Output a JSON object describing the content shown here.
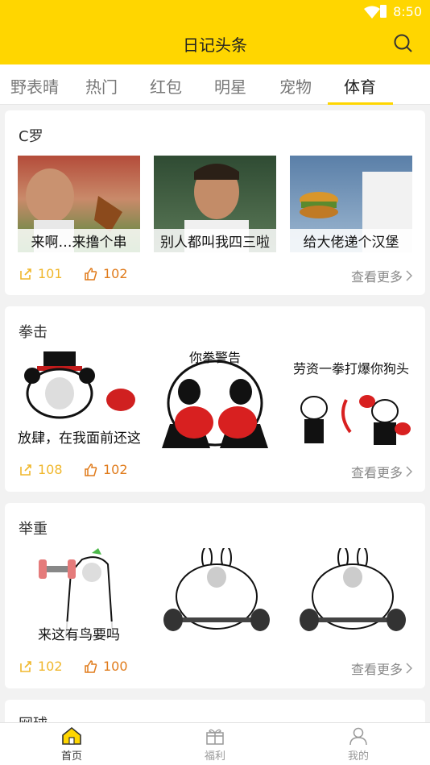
{
  "status": {
    "time": "8:50"
  },
  "appbar": {
    "title": "日记头条",
    "search_icon": "search-icon"
  },
  "tabs": [
    {
      "label": "野表晴"
    },
    {
      "label": "热门"
    },
    {
      "label": "红包"
    },
    {
      "label": "明星"
    },
    {
      "label": "宠物"
    },
    {
      "label": "体育",
      "active": true
    }
  ],
  "cards": [
    {
      "title": "C罗",
      "images": [
        {
          "caption": "来啊…来撸个串"
        },
        {
          "caption": "别人都叫我四三啦"
        },
        {
          "caption": "给大佬递个汉堡"
        }
      ],
      "shares": "101",
      "likes": "102",
      "more": "查看更多"
    },
    {
      "title": "拳击",
      "images": [
        {
          "caption": "放肆，在我面前还这么嚣张！"
        },
        {
          "caption": "你拳警告"
        },
        {
          "caption": "劳资一拳打爆你狗头"
        }
      ],
      "shares": "108",
      "likes": "102",
      "more": "查看更多"
    },
    {
      "title": "举重",
      "images": [
        {
          "caption": "来这有鸟要吗"
        },
        {
          "caption": ""
        },
        {
          "caption": ""
        }
      ],
      "shares": "102",
      "likes": "100",
      "more": "查看更多"
    },
    {
      "title": "网球"
    }
  ],
  "bottomnav": [
    {
      "label": "首页",
      "icon": "home-icon",
      "active": true
    },
    {
      "label": "福利",
      "icon": "gift-icon"
    },
    {
      "label": "我的",
      "icon": "user-icon"
    }
  ],
  "colors": {
    "brand": "#ffd600",
    "share": "#f0b72c",
    "like": "#e07b1b"
  }
}
